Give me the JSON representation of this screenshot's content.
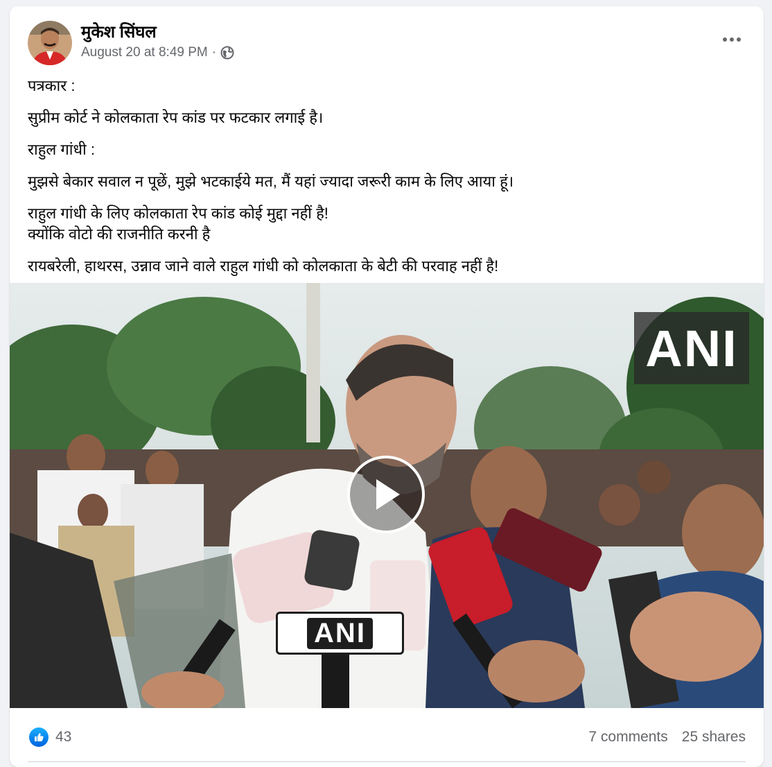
{
  "post": {
    "author": "मुकेश सिंघल",
    "timestamp": "August 20 at 8:49 PM",
    "separator": "·",
    "privacy_icon": "globe-icon",
    "more_icon": "more-options-icon"
  },
  "content": {
    "line1": "पत्रकार :",
    "line2": "सुप्रीम कोर्ट ने कोलकाता रेप कांड पर फटकार लगाई है।",
    "line3": "राहुल गांधी :",
    "line4": "मुझसे बेकार सवाल न पूछें, मुझे भटकाईये मत, मैं यहां ज्यादा जरूरी काम के लिए आया हूं।",
    "line5": "राहुल गांधी के लिए कोलकाता रेप कांड कोई मुद्दा नहीं है!",
    "line6": "क्योंकि वोटो की राजनीति करनी है",
    "line7": "रायबरेली, हाथरस, उन्नाव जाने वाले राहुल गांधी को कोलकाता के बेटी की परवाह नहीं है!"
  },
  "video": {
    "watermark": "ANI",
    "mic_label": "ANI",
    "play_icon": "play-icon"
  },
  "stats": {
    "reaction_icon": "like-icon",
    "reactions": "43",
    "comments": "7 comments",
    "shares": "25 shares"
  },
  "colors": {
    "like_blue": "#0866ff",
    "secondary_text": "#65676b"
  }
}
